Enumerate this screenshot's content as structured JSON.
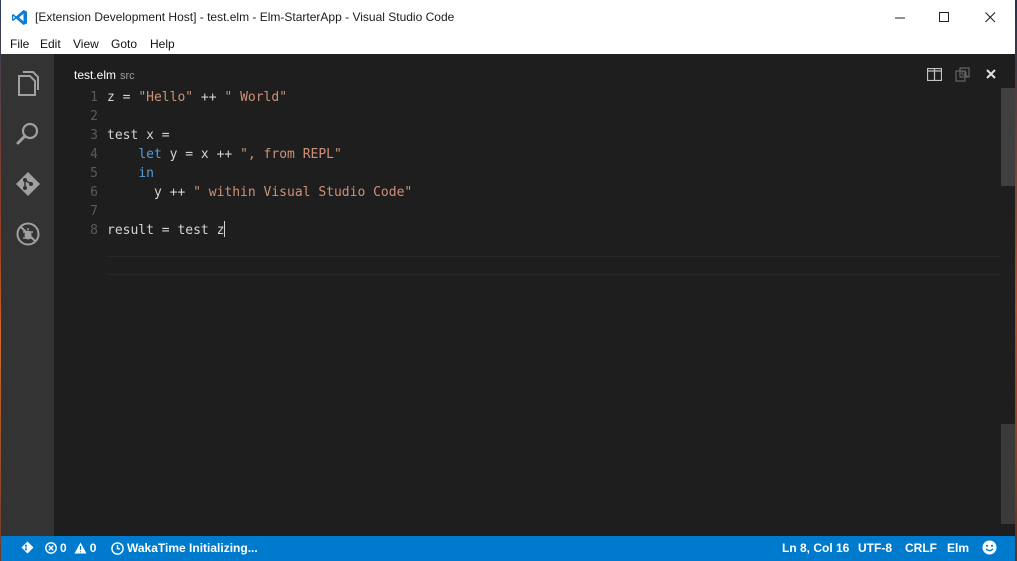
{
  "window": {
    "title": "[Extension Development Host] - test.elm - Elm-StarterApp - Visual Studio Code"
  },
  "menu": [
    "File",
    "Edit",
    "View",
    "Goto",
    "Help"
  ],
  "activity_bar": {
    "icons": [
      "explorer-icon",
      "search-icon",
      "git-icon",
      "debug-icon"
    ]
  },
  "editor": {
    "tab": {
      "filename": "test.elm",
      "path": "src"
    },
    "actions": [
      "split-editor-icon",
      "open-changes-icon",
      "close-icon"
    ],
    "lines": [
      {
        "num": "1",
        "segments": [
          [
            "z ",
            "op"
          ],
          [
            "= ",
            "op"
          ],
          [
            "\"Hello\"",
            "str"
          ],
          [
            " ++ ",
            "op"
          ],
          [
            "\" World\"",
            "str"
          ]
        ]
      },
      {
        "num": "2",
        "segments": []
      },
      {
        "num": "3",
        "segments": [
          [
            "test x ",
            "op"
          ],
          [
            "=",
            "op"
          ]
        ]
      },
      {
        "num": "4",
        "segments": [
          [
            "    ",
            "op"
          ],
          [
            "let",
            "kw"
          ],
          [
            " y = x ++ ",
            "op"
          ],
          [
            "\", from REPL\"",
            "str"
          ]
        ]
      },
      {
        "num": "5",
        "segments": [
          [
            "    ",
            "op"
          ],
          [
            "in",
            "kw"
          ]
        ]
      },
      {
        "num": "6",
        "segments": [
          [
            "      y ++ ",
            "op"
          ],
          [
            "\" within Visual Studio Code\"",
            "str"
          ]
        ]
      },
      {
        "num": "7",
        "segments": []
      },
      {
        "num": "8",
        "segments": [
          [
            "result = test z",
            "op"
          ]
        ]
      }
    ]
  },
  "status_bar": {
    "errors": "0",
    "warnings": "0",
    "wakatime": "WakaTime Initializing...",
    "position": "Ln 8, Col 16",
    "encoding": "UTF-8",
    "eol": "CRLF",
    "language": "Elm"
  },
  "colors": {
    "statusbar": "#007acc",
    "activitybar": "#333333",
    "editor_bg": "#1e1e1e",
    "keyword": "#569cd6",
    "string": "#ce9178"
  }
}
